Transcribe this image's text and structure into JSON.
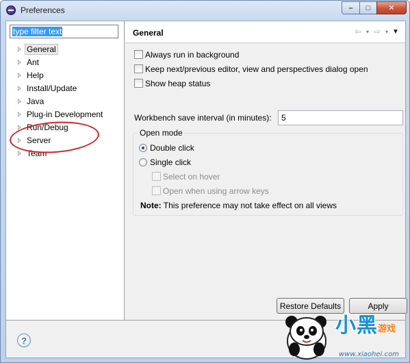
{
  "window": {
    "title": "Preferences",
    "controls": {
      "minimize": "–",
      "maximize": "□",
      "close": "✕"
    }
  },
  "sidebar": {
    "filter_placeholder": "type filter text",
    "items": [
      {
        "label": "General",
        "selected": true
      },
      {
        "label": "Ant"
      },
      {
        "label": "Help"
      },
      {
        "label": "Install/Update"
      },
      {
        "label": "Java"
      },
      {
        "label": "Plug-in Development"
      },
      {
        "label": "Run/Debug"
      },
      {
        "label": "Server"
      },
      {
        "label": "Team"
      }
    ]
  },
  "header": {
    "title": "General",
    "nav": {
      "back": "⇦",
      "forward": "⇨",
      "dropdown": "▾",
      "menu": "▼"
    }
  },
  "main": {
    "options": [
      {
        "label": "Always run in background",
        "checked": false
      },
      {
        "label": "Keep next/previous editor, view and perspectives dialog open",
        "checked": false
      },
      {
        "label": "Show heap status",
        "checked": false
      }
    ],
    "interval_label": "Workbench save interval (in minutes):",
    "interval_value": "5",
    "open_mode": {
      "title": "Open mode",
      "double_click": "Double click",
      "single_click": "Single click",
      "select_on_hover": "Select on hover",
      "open_arrow_keys": "Open when using arrow keys",
      "note_bold": "Note:",
      "note_text": " This preference may not take effect on all views"
    },
    "restore_defaults": "Restore Defaults",
    "apply": "Apply"
  },
  "footer": {
    "help": "?"
  },
  "watermark": {
    "brand": "小黑",
    "sub": "游戏",
    "url": "www.xiaohei.com"
  },
  "colors": {
    "accent": "#3399ff",
    "annotation": "#d42020"
  }
}
